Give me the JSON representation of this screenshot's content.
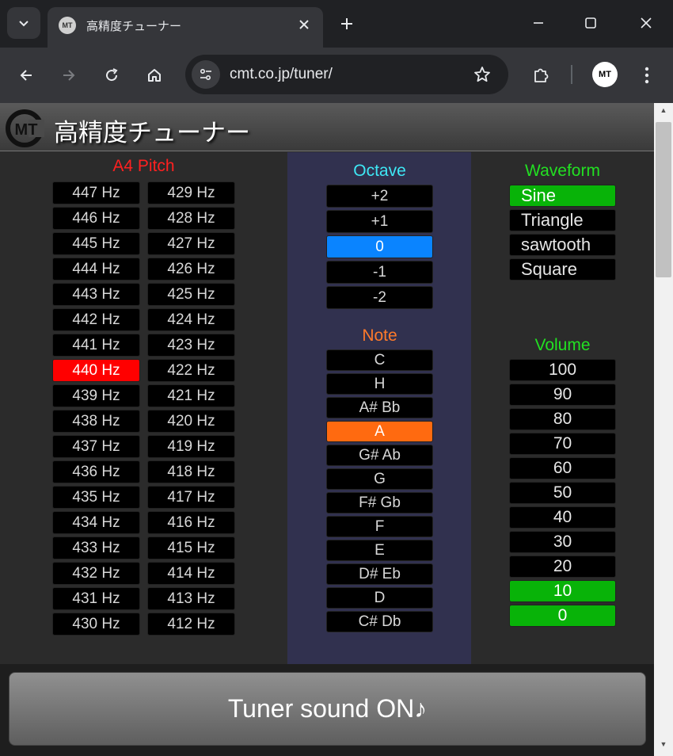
{
  "browser": {
    "tab_title": "高精度チューナー",
    "url": "cmt.co.jp/tuner/"
  },
  "app": {
    "title": "高精度チューナー",
    "logo_text": "MT"
  },
  "pitch": {
    "title": "A4 Pitch",
    "left": [
      "447 Hz",
      "446 Hz",
      "445 Hz",
      "444 Hz",
      "443 Hz",
      "442 Hz",
      "441 Hz",
      "440 Hz",
      "439 Hz",
      "438 Hz",
      "437 Hz",
      "436 Hz",
      "435 Hz",
      "434 Hz",
      "433 Hz",
      "432 Hz",
      "431 Hz",
      "430 Hz"
    ],
    "right": [
      "429 Hz",
      "428 Hz",
      "427 Hz",
      "426 Hz",
      "425 Hz",
      "424 Hz",
      "423 Hz",
      "422 Hz",
      "421 Hz",
      "420 Hz",
      "419 Hz",
      "418 Hz",
      "417 Hz",
      "416 Hz",
      "415 Hz",
      "414 Hz",
      "413 Hz",
      "412 Hz"
    ],
    "selected": "440 Hz",
    "title_color": "#ff2020",
    "selected_color": "#ff0000"
  },
  "octave": {
    "title": "Octave",
    "items": [
      "+2",
      "+1",
      "0",
      "-1",
      "-2"
    ],
    "selected": "0",
    "title_color": "#3ee8f5",
    "selected_color": "#0a84ff"
  },
  "note": {
    "title": "Note",
    "items": [
      "C",
      "H",
      "A# Bb",
      "A",
      "G# Ab",
      "G",
      "F# Gb",
      "F",
      "E",
      "D# Eb",
      "D",
      "C# Db"
    ],
    "selected": "A",
    "title_color": "#ff7a2a",
    "selected_color": "#ff6a10"
  },
  "waveform": {
    "title": "Waveform",
    "items": [
      "Sine",
      "Triangle",
      "sawtooth",
      "Square"
    ],
    "selected": "Sine",
    "title_color": "#22e022",
    "selected_color": "#08b308"
  },
  "volume": {
    "title": "Volume",
    "items": [
      "100",
      "90",
      "80",
      "70",
      "60",
      "50",
      "40",
      "30",
      "20",
      "10",
      "0"
    ],
    "selected": [
      "10",
      "0"
    ],
    "title_color": "#22e022",
    "selected_color": "#08b308"
  },
  "sound_button": {
    "label": "Tuner sound ON♪"
  }
}
